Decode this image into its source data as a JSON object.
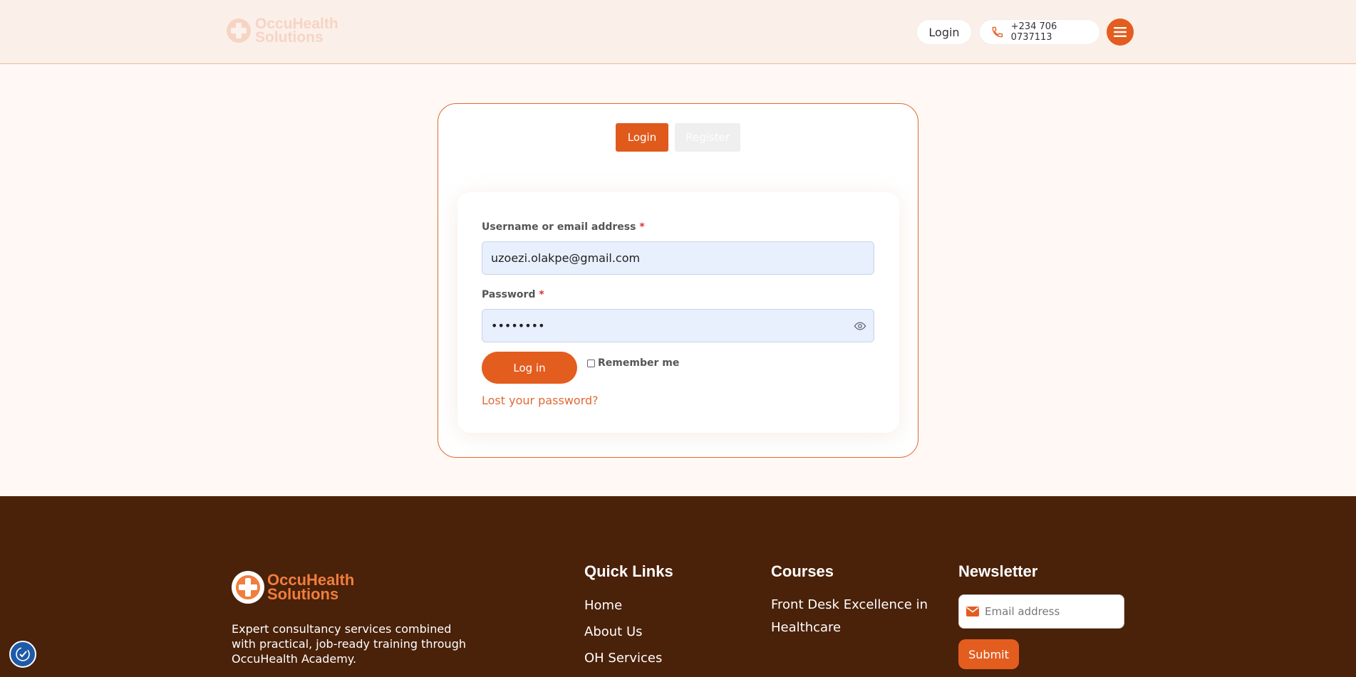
{
  "header": {
    "logo_line1": "OccuHealth",
    "logo_line2": "Solutions",
    "login_label": "Login",
    "phone": "+234 706 0737113"
  },
  "auth": {
    "tab_login": "Login",
    "tab_register": "Register",
    "username_label": "Username or email address",
    "username_value": "uzoezi.olakpe@gmail.com",
    "password_label": "Password",
    "password_value": "••••••••",
    "required_mark": "*",
    "login_button": "Log in",
    "remember_label": "Remember me",
    "lost_password": "Lost your password?"
  },
  "footer": {
    "logo_line1": "OccuHealth",
    "logo_line2": "Solutions",
    "description": "Expert consultancy services combined with practical, job-ready training through OccuHealth Academy.",
    "quick_links_title": "Quick Links",
    "quick_links": [
      "Home",
      "About Us",
      "OH Services"
    ],
    "courses_title": "Courses",
    "course_item": "Front Desk Excellence in Healthcare",
    "newsletter_title": "Newsletter",
    "email_placeholder": "Email address",
    "submit_label": "Submit"
  },
  "colors": {
    "accent": "#e35d1f",
    "footer_bg": "#4a2109",
    "header_bg": "#fbefe9"
  }
}
